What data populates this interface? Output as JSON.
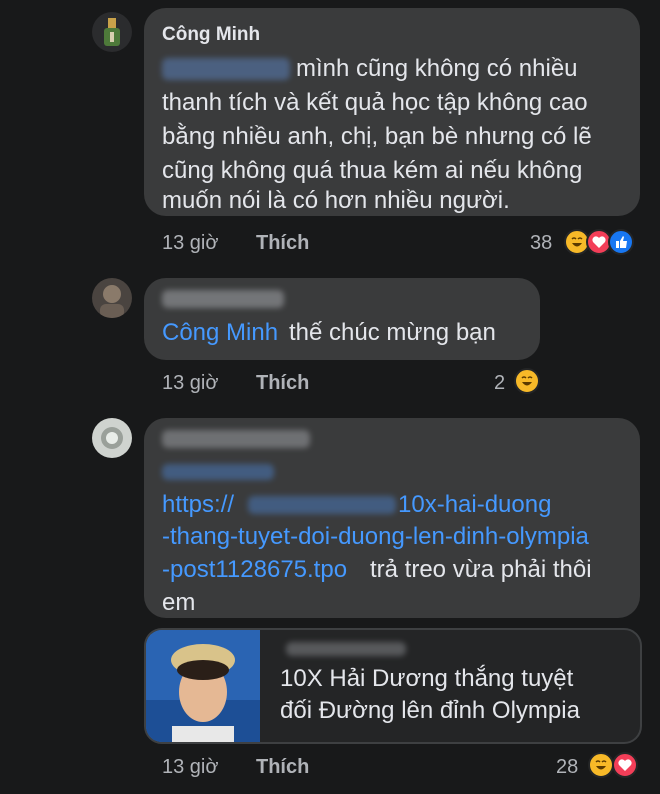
{
  "comments": [
    {
      "author": "Công Minh",
      "text_lines": [
        "mình cũng không có nhiều",
        "thanh tích và kết quả học tập không cao",
        "bằng nhiều anh, chị, bạn bè nhưng có lẽ",
        "cũng không quá thua kém ai nếu không",
        "muốn nói là có hơn nhiều người."
      ],
      "time": "13 giờ",
      "like_label": "Thích",
      "reaction_count": "38",
      "reactions": [
        "haha-icon",
        "love-icon",
        "like-icon"
      ]
    },
    {
      "mention": "Công Minh",
      "text": "thế chúc mừng bạn",
      "time": "13 giờ",
      "like_label": "Thích",
      "reaction_count": "2",
      "reactions": [
        "haha-icon"
      ]
    },
    {
      "link_lines": [
        "https://",
        "10x-hai-duong",
        "-thang-tuyet-doi-duong-len-dinh-olympia",
        "-post1128675.tpo"
      ],
      "text_after_link": "trả treo vừa phải thôi",
      "text_end": "em",
      "preview_title_lines": [
        "10X Hải Dương thắng tuyệt",
        "đối Đường lên đỉnh Olympia"
      ],
      "time": "13 giờ",
      "like_label": "Thích",
      "reaction_count": "28",
      "reactions": [
        "haha-icon",
        "love-icon"
      ]
    }
  ],
  "colors": {
    "background": "#18191a",
    "bubble": "#3a3b3c",
    "link": "#4599ff",
    "meta": "#b0b3b8"
  }
}
